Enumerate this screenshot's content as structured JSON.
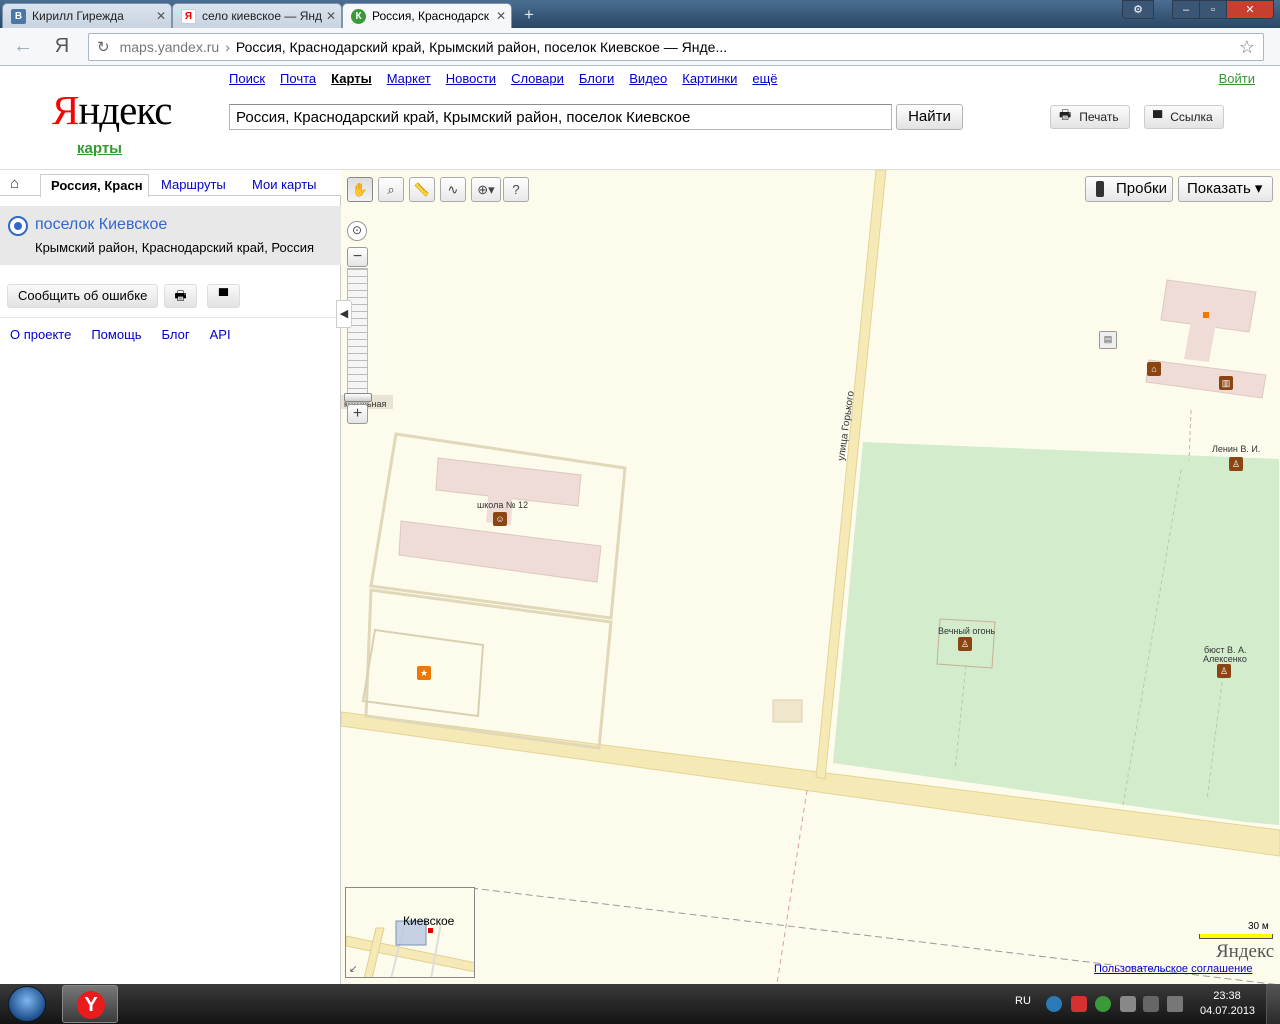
{
  "browser": {
    "tabs": [
      {
        "title": "Кирилл Гирежда",
        "favicon": "В"
      },
      {
        "title": "село киевское — Янд",
        "favicon": "Я"
      },
      {
        "title": "Россия, Краснодарск",
        "favicon": "К"
      }
    ],
    "new_tab": "+",
    "window_controls": {
      "settings": "⚙",
      "minimize": "–",
      "maximize": "▫",
      "close": "✕"
    },
    "url_host": "maps.yandex.ru",
    "url_sep": "›",
    "url_title": "Россия, Краснодарский край, Крымский район, поселок Киевское — Янде..."
  },
  "header": {
    "logo_first": "Я",
    "logo_rest": "ндекс",
    "logo_sub": "карты",
    "services": [
      {
        "label": "Поиск"
      },
      {
        "label": "Почта"
      },
      {
        "label": "Карты",
        "current": true
      },
      {
        "label": "Маркет"
      },
      {
        "label": "Новости"
      },
      {
        "label": "Словари"
      },
      {
        "label": "Блоги"
      },
      {
        "label": "Видео"
      },
      {
        "label": "Картинки"
      },
      {
        "label": "ещё"
      }
    ],
    "login": "Войти",
    "search_value": "Россия, Краснодарский край, Крымский район, поселок Киевское",
    "find_label": "Найти",
    "print_label": "Печать",
    "link_label": "Ссылка"
  },
  "sidebar": {
    "tab_current": "Россия, Красн",
    "tab_routes": "Маршруты",
    "tab_mymaps": "Мои карты",
    "result_title": "поселок Киевское",
    "result_sub": "Крымский район, Краснодарский край, Россия",
    "report_label": "Сообщить об ошибке",
    "links": [
      "О проекте",
      "Помощь",
      "Блог",
      "API"
    ],
    "collapse": "◀"
  },
  "map": {
    "traffic_label": "Пробки",
    "show_label": "Показать ▾",
    "labels": {
      "boiler": "котельная",
      "school": "школа № 12",
      "street": "улица Горького",
      "lenin": "Ленин В. И.",
      "fire": "Вечный огонь",
      "bust1": "бюст В. А.",
      "bust2": "Алексенко"
    },
    "minimap_label": "Киевское",
    "scale_label": "30 м",
    "brand": "Яндекс",
    "terms": "Пользовательское соглашение"
  },
  "taskbar": {
    "lang": "RU",
    "time": "23:38",
    "date": "04.07.2013"
  },
  "colors": {
    "accent_link": "#0000cc",
    "brand_red": "#ff0000",
    "park_green": "#d2eccc",
    "building": "#f0dcd6",
    "road": "#f5e9b6"
  }
}
